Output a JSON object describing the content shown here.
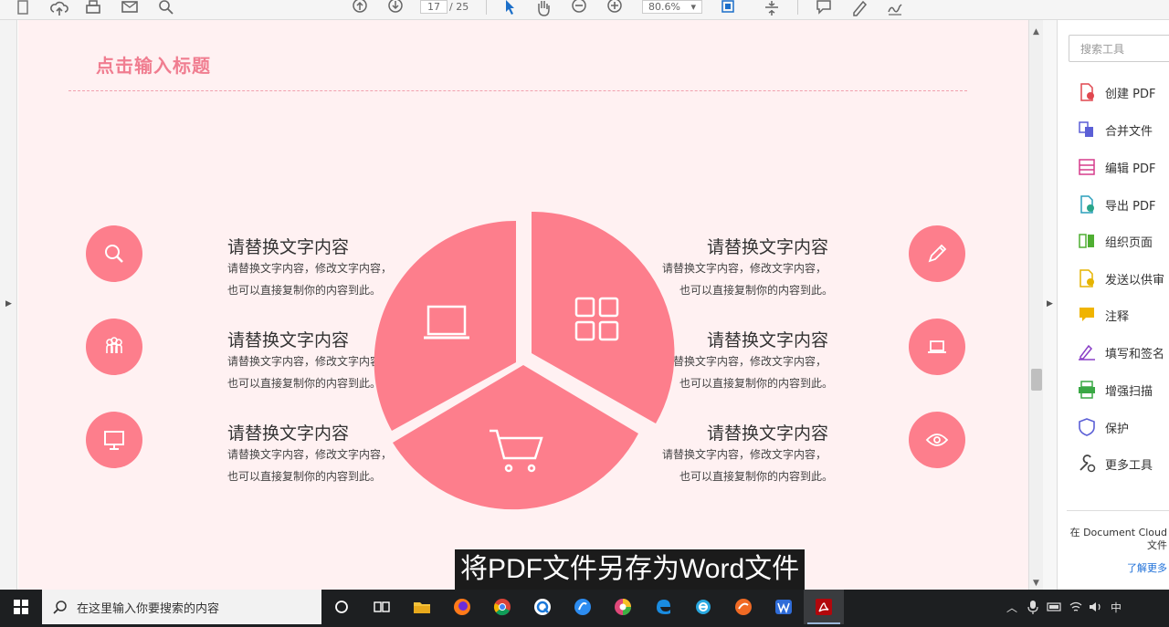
{
  "toolbar": {
    "page_current": "17",
    "page_total": "/ 25",
    "zoom": "80.6%",
    "zoom_arrow": "▾"
  },
  "document": {
    "title": "点击输入标题",
    "left_items": [
      {
        "icon": "search-icon",
        "title": "请替换文字内容",
        "line1": "请替换文字内容，修改文字内容，",
        "line2": "也可以直接复制你的内容到此。"
      },
      {
        "icon": "people-icon",
        "title": "请替换文字内容",
        "line1": "请替换文字内容，修改文字内容，",
        "line2": "也可以直接复制你的内容到此。"
      },
      {
        "icon": "monitor-icon",
        "title": "请替换文字内容",
        "line1": "请替换文字内容，修改文字内容，",
        "line2": "也可以直接复制你的内容到此。"
      }
    ],
    "right_items": [
      {
        "icon": "pencil-icon",
        "title": "请替换文字内容",
        "line1": "请替换文字内容，修改文字内容，",
        "line2": "也可以直接复制你的内容到此。"
      },
      {
        "icon": "laptop-icon",
        "title": "请替换文字内容",
        "line1": "请替换文字内容，修改文字内容，",
        "line2": "也可以直接复制你的内容到此。"
      },
      {
        "icon": "eye-icon",
        "title": "请替换文字内容",
        "line1": "请替换文字内容，修改文字内容，",
        "line2": "也可以直接复制你的内容到此。"
      }
    ],
    "pie_icons": [
      "laptop-icon",
      "grid-icon",
      "cart-icon"
    ],
    "accent_color": "#fd7e8c",
    "title_color": "#f07d90",
    "page_background": "#fff1f2"
  },
  "subtitle": "将PDF文件另存为Word文件",
  "tools_pane": {
    "search_placeholder": "搜索工具",
    "tools": [
      {
        "icon": "create-pdf-icon",
        "label": "创建 PDF"
      },
      {
        "icon": "combine-files-icon",
        "label": "合并文件"
      },
      {
        "icon": "edit-pdf-icon",
        "label": "编辑 PDF"
      },
      {
        "icon": "export-pdf-icon",
        "label": "导出 PDF"
      },
      {
        "icon": "organize-pages-icon",
        "label": "组织页面"
      },
      {
        "icon": "send-for-review-icon",
        "label": "发送以供审"
      },
      {
        "icon": "comment-icon",
        "label": "注释"
      },
      {
        "icon": "fill-sign-icon",
        "label": "填写和签名"
      },
      {
        "icon": "enhance-scan-icon",
        "label": "增强扫描"
      },
      {
        "icon": "protect-icon",
        "label": "保护"
      },
      {
        "icon": "more-tools-icon",
        "label": "更多工具"
      }
    ],
    "cloud_line1": "在 Document Cloud",
    "cloud_line2": "文件",
    "cloud_link": "了解更多"
  },
  "taskbar": {
    "search_placeholder": "在这里输入你要搜索的内容",
    "tray_ime": "中"
  }
}
